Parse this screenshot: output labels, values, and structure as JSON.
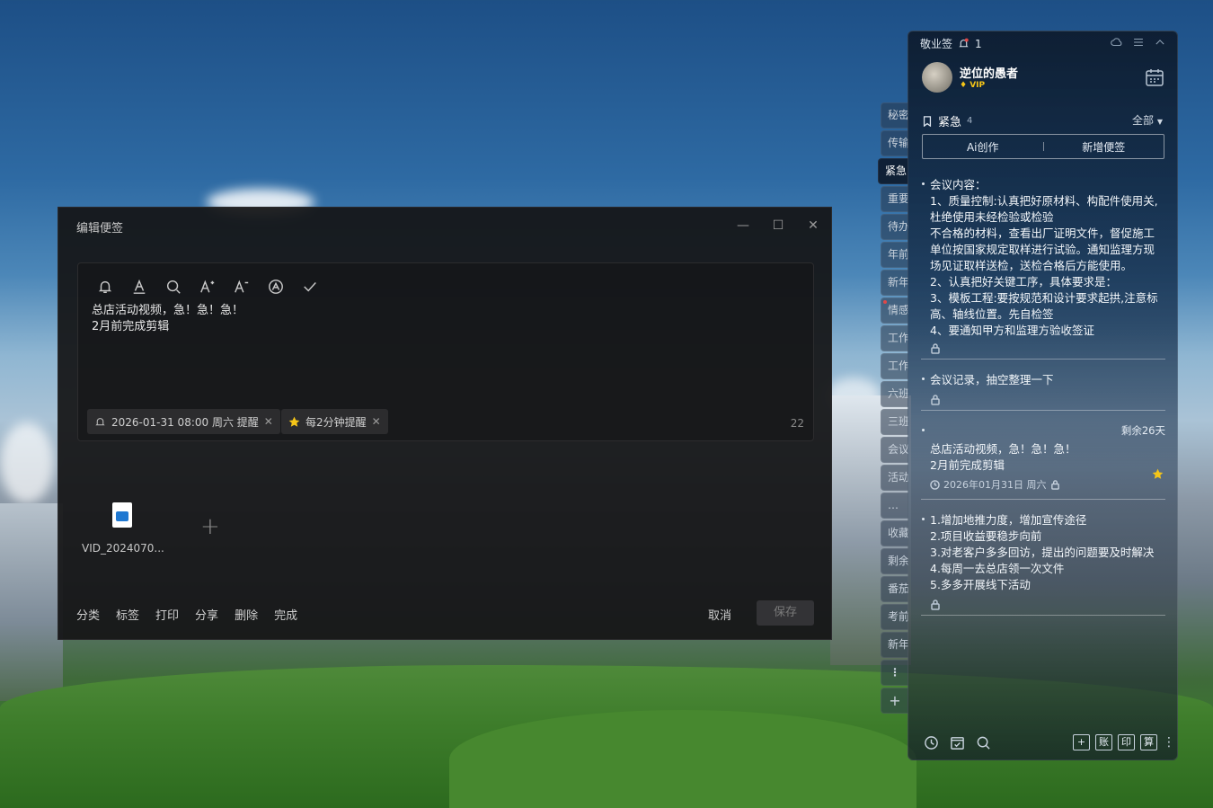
{
  "dialog": {
    "title": "编辑便签",
    "minimize_glyph": "—",
    "maximize_glyph": "☐",
    "close_glyph": "✕",
    "content_lines": [
      "总店活动视频，急！急！急！",
      "2月前完成剪辑"
    ],
    "reminder_chip": "2026-01-31 08:00 周六 提醒",
    "repeat_chip": "每2分钟提醒",
    "char_count": "22",
    "attachment_name": "VID_2024070...",
    "footer": [
      "分类",
      "标签",
      "打印",
      "分享",
      "删除",
      "完成"
    ],
    "cancel_label": "取消",
    "save_label": "保存"
  },
  "tabs": [
    "秘密",
    "传输",
    "紧急",
    "重要",
    "待办",
    "年前",
    "新年",
    "情感",
    "工作",
    "工作",
    "六班",
    "三班",
    "会议",
    "活动",
    "…",
    "收藏",
    "剩余",
    "番茄",
    "考前",
    "新年"
  ],
  "tabs_more": "⋮",
  "tabs_add": "+",
  "panel": {
    "app_name": "敬业签",
    "notify_count": "1",
    "username": "逆位的愚者",
    "vip": "VIP",
    "category": "紧急",
    "category_count": "4",
    "filter": "全部",
    "ai_label": "Ai创作",
    "new_label": "新增便签",
    "notes": [
      {
        "text": "会议内容：\n1、质量控制:认真把好原材料、构配件使用关,杜绝使用未经检验或检验\n不合格的材料，查看出厂证明文件，督促施工单位按国家规定取样进行试验。通知监理方现场见证取样送检，送检合格后方能使用。\n2、认真把好关键工序，具体要求是：\n3、模板工程:要按规范和设计要求起拱,注意标高、轴线位置。先自检签\n4、要通知甲方和监理方验收签证"
      },
      {
        "text": "会议记录，抽空整理一下"
      },
      {
        "remain": "剩余26天",
        "text": "总店活动视频，急！急！急！\n2月前完成剪辑",
        "date": "2026年01月31日 周六"
      },
      {
        "text": "1.增加地推力度，增加宣传途径\n2.项目收益要稳步向前\n3.对老客户多多回访，提出的问题要及时解决\n4.每周一去总店领一次文件\n5.多多开展线下活动"
      }
    ],
    "footer_buttons": [
      "+",
      "账",
      "印",
      "算"
    ]
  },
  "colors": {
    "accent_star": "#f5c518",
    "vip": "#f5c518"
  }
}
